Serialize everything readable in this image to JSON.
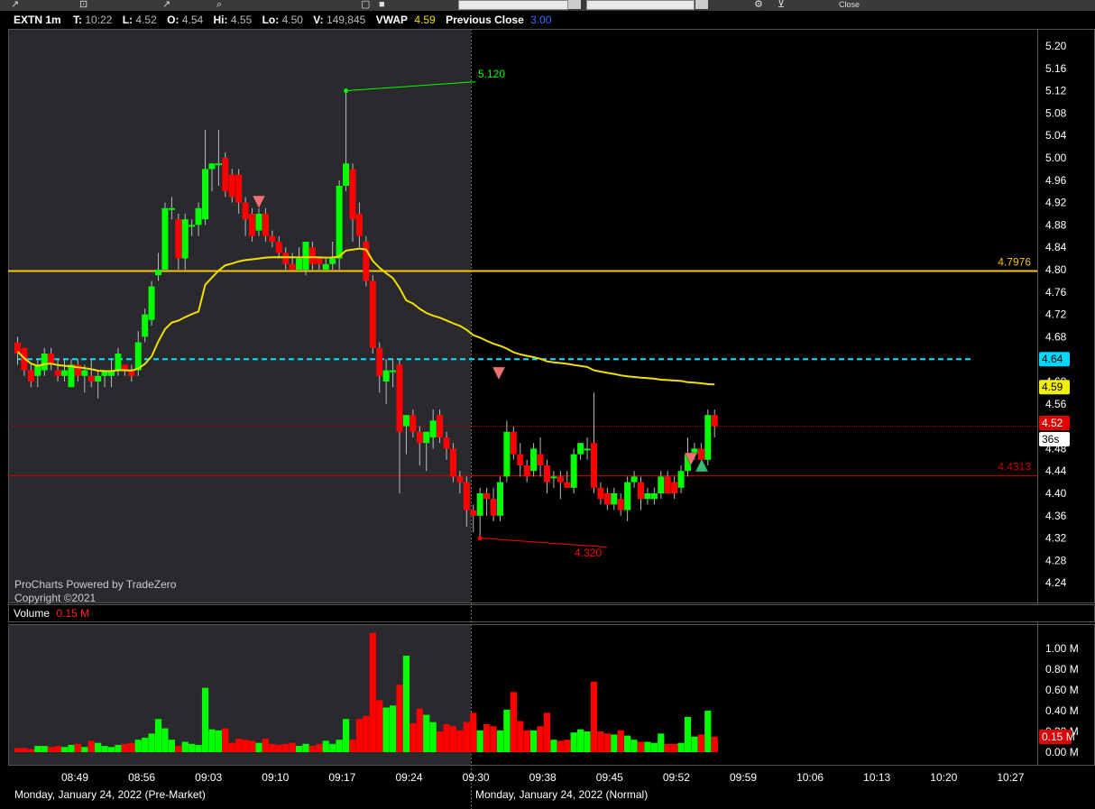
{
  "toolbar": {
    "icons": [
      "cursor-icon",
      "crosshair-icon",
      "draw-line-icon",
      "zoom-icon",
      "undo-icon",
      "save-icon",
      "settings-icon",
      "gear-icon",
      "close-icon"
    ],
    "close_label": "Close"
  },
  "info_bar": {
    "symbol": "EXTN 1m",
    "t_label": "T:",
    "t_value": "10:22",
    "l_label": "L:",
    "l_value": "4.52",
    "o_label": "O:",
    "o_value": "4.54",
    "hi_label": "Hi:",
    "hi_value": "4.55",
    "lo_label": "Lo:",
    "lo_value": "4.50",
    "v_label": "V:",
    "v_value": "149,845",
    "vwap_label": "VWAP",
    "vwap_value": "4.59",
    "prev_label": "Previous Close",
    "prev_value": "3.00"
  },
  "watermark": {
    "line1": "ProCharts Powered by TradeZero",
    "line2": "Copyright ©2021"
  },
  "volume_header": {
    "label": "Volume",
    "value": "0.15 M"
  },
  "sessions": {
    "premarket": "Monday, January 24, 2022 (Pre-Market)",
    "normal": "Monday, January 24, 2022 (Normal)"
  },
  "colors": {
    "up": "#00ff00",
    "down": "#ff0000",
    "vwap": "#f0e000",
    "dashed": "#00e5ff",
    "level": "#f5c518",
    "redline": "#cc0000"
  },
  "chart_data": {
    "type": "candlestick",
    "symbol": "EXTN",
    "interval": "1m",
    "time_axis": [
      "08:49",
      "08:56",
      "09:03",
      "09:10",
      "09:17",
      "09:24",
      "09:30",
      "09:38",
      "09:45",
      "09:52",
      "09:59",
      "10:06",
      "10:13",
      "10:20",
      "10:27"
    ],
    "price_axis": [
      "5.20",
      "5.16",
      "5.12",
      "5.08",
      "5.04",
      "5.00",
      "4.96",
      "4.92",
      "4.88",
      "4.84",
      "4.80",
      "4.76",
      "4.72",
      "4.68",
      "4.64",
      "4.60",
      "4.56",
      "4.52",
      "4.48",
      "4.44",
      "4.40",
      "4.36",
      "4.32",
      "4.28",
      "4.24"
    ],
    "ylim": [
      4.2,
      5.22
    ],
    "volume_axis": [
      "1.00 M",
      "0.80 M",
      "0.60 M",
      "0.40 M",
      "0.20 M",
      "0.00 M"
    ],
    "volume_ylim": [
      0,
      1.1
    ],
    "candles": [
      {
        "o": 4.67,
        "h": 4.68,
        "l": 4.63,
        "c": 4.65
      },
      {
        "o": 4.66,
        "h": 4.66,
        "l": 4.61,
        "c": 4.62
      },
      {
        "o": 4.62,
        "h": 4.63,
        "l": 4.59,
        "c": 4.6
      },
      {
        "o": 4.61,
        "h": 4.64,
        "l": 4.59,
        "c": 4.63
      },
      {
        "o": 4.62,
        "h": 4.66,
        "l": 4.61,
        "c": 4.65
      },
      {
        "o": 4.65,
        "h": 4.66,
        "l": 4.62,
        "c": 4.63
      },
      {
        "o": 4.62,
        "h": 4.64,
        "l": 4.6,
        "c": 4.61
      },
      {
        "o": 4.61,
        "h": 4.64,
        "l": 4.6,
        "c": 4.62
      },
      {
        "o": 4.59,
        "h": 4.64,
        "l": 4.59,
        "c": 4.63
      },
      {
        "o": 4.63,
        "h": 4.64,
        "l": 4.6,
        "c": 4.61
      },
      {
        "o": 4.61,
        "h": 4.63,
        "l": 4.58,
        "c": 4.62
      },
      {
        "o": 4.61,
        "h": 4.64,
        "l": 4.59,
        "c": 4.6
      },
      {
        "o": 4.6,
        "h": 4.62,
        "l": 4.57,
        "c": 4.61
      },
      {
        "o": 4.61,
        "h": 4.62,
        "l": 4.59,
        "c": 4.62
      },
      {
        "o": 4.61,
        "h": 4.64,
        "l": 4.59,
        "c": 4.62
      },
      {
        "o": 4.62,
        "h": 4.66,
        "l": 4.61,
        "c": 4.65
      },
      {
        "o": 4.63,
        "h": 4.63,
        "l": 4.61,
        "c": 4.62
      },
      {
        "o": 4.62,
        "h": 4.63,
        "l": 4.6,
        "c": 4.61
      },
      {
        "o": 4.62,
        "h": 4.69,
        "l": 4.61,
        "c": 4.67
      },
      {
        "o": 4.68,
        "h": 4.73,
        "l": 4.67,
        "c": 4.72
      },
      {
        "o": 4.71,
        "h": 4.78,
        "l": 4.7,
        "c": 4.77
      },
      {
        "o": 4.79,
        "h": 4.83,
        "l": 4.78,
        "c": 4.8
      },
      {
        "o": 4.8,
        "h": 4.92,
        "l": 4.8,
        "c": 4.91
      },
      {
        "o": 4.91,
        "h": 4.93,
        "l": 4.89,
        "c": 4.91
      },
      {
        "o": 4.89,
        "h": 4.9,
        "l": 4.8,
        "c": 4.82
      },
      {
        "o": 4.82,
        "h": 4.9,
        "l": 4.8,
        "c": 4.89
      },
      {
        "o": 4.88,
        "h": 4.89,
        "l": 4.86,
        "c": 4.88
      },
      {
        "o": 4.88,
        "h": 4.92,
        "l": 4.86,
        "c": 4.91
      },
      {
        "o": 4.89,
        "h": 5.05,
        "l": 4.88,
        "c": 4.98
      },
      {
        "o": 4.98,
        "h": 4.99,
        "l": 4.94,
        "c": 4.99
      },
      {
        "o": 4.99,
        "h": 5.05,
        "l": 4.95,
        "c": 4.99
      },
      {
        "o": 5.0,
        "h": 5.01,
        "l": 4.93,
        "c": 4.94
      },
      {
        "o": 4.97,
        "h": 4.98,
        "l": 4.92,
        "c": 4.93
      },
      {
        "o": 4.97,
        "h": 4.98,
        "l": 4.9,
        "c": 4.92
      },
      {
        "o": 4.92,
        "h": 4.93,
        "l": 4.86,
        "c": 4.89
      },
      {
        "o": 4.9,
        "h": 4.91,
        "l": 4.85,
        "c": 4.86
      },
      {
        "o": 4.87,
        "h": 4.91,
        "l": 4.86,
        "c": 4.9
      },
      {
        "o": 4.9,
        "h": 4.91,
        "l": 4.85,
        "c": 4.86
      },
      {
        "o": 4.86,
        "h": 4.87,
        "l": 4.84,
        "c": 4.85
      },
      {
        "o": 4.85,
        "h": 4.86,
        "l": 4.82,
        "c": 4.83
      },
      {
        "o": 4.83,
        "h": 4.84,
        "l": 4.8,
        "c": 4.81
      },
      {
        "o": 4.81,
        "h": 4.83,
        "l": 4.8,
        "c": 4.8
      },
      {
        "o": 4.8,
        "h": 4.84,
        "l": 4.8,
        "c": 4.82
      },
      {
        "o": 4.8,
        "h": 4.85,
        "l": 4.79,
        "c": 4.85
      },
      {
        "o": 4.84,
        "h": 4.85,
        "l": 4.8,
        "c": 4.81
      },
      {
        "o": 4.82,
        "h": 4.82,
        "l": 4.8,
        "c": 4.81
      },
      {
        "o": 4.8,
        "h": 4.82,
        "l": 4.8,
        "c": 4.81
      },
      {
        "o": 4.81,
        "h": 4.85,
        "l": 4.8,
        "c": 4.82
      },
      {
        "o": 4.82,
        "h": 4.96,
        "l": 4.8,
        "c": 4.95
      },
      {
        "o": 4.95,
        "h": 5.12,
        "l": 4.94,
        "c": 4.99
      },
      {
        "o": 4.98,
        "h": 4.99,
        "l": 4.85,
        "c": 4.89
      },
      {
        "o": 4.9,
        "h": 4.92,
        "l": 4.84,
        "c": 4.86
      },
      {
        "o": 4.85,
        "h": 4.86,
        "l": 4.77,
        "c": 4.78
      },
      {
        "o": 4.78,
        "h": 4.79,
        "l": 4.65,
        "c": 4.66
      },
      {
        "o": 4.66,
        "h": 4.67,
        "l": 4.58,
        "c": 4.61
      },
      {
        "o": 4.6,
        "h": 4.64,
        "l": 4.56,
        "c": 4.62
      },
      {
        "o": 4.62,
        "h": 4.64,
        "l": 4.59,
        "c": 4.62
      },
      {
        "o": 4.63,
        "h": 4.64,
        "l": 4.4,
        "c": 4.51
      },
      {
        "o": 4.52,
        "h": 4.54,
        "l": 4.47,
        "c": 4.54
      },
      {
        "o": 4.54,
        "h": 4.55,
        "l": 4.5,
        "c": 4.51
      },
      {
        "o": 4.51,
        "h": 4.52,
        "l": 4.45,
        "c": 4.49
      },
      {
        "o": 4.49,
        "h": 4.51,
        "l": 4.44,
        "c": 4.51
      },
      {
        "o": 4.5,
        "h": 4.55,
        "l": 4.48,
        "c": 4.53
      },
      {
        "o": 4.54,
        "h": 4.55,
        "l": 4.49,
        "c": 4.5
      },
      {
        "o": 4.5,
        "h": 4.51,
        "l": 4.46,
        "c": 4.48
      },
      {
        "o": 4.48,
        "h": 4.49,
        "l": 4.42,
        "c": 4.43
      },
      {
        "o": 4.43,
        "h": 4.44,
        "l": 4.4,
        "c": 4.42
      },
      {
        "o": 4.42,
        "h": 4.43,
        "l": 4.34,
        "c": 4.37
      },
      {
        "o": 4.37,
        "h": 4.38,
        "l": 4.33,
        "c": 4.36
      },
      {
        "o": 4.36,
        "h": 4.41,
        "l": 4.32,
        "c": 4.4
      },
      {
        "o": 4.4,
        "h": 4.41,
        "l": 4.36,
        "c": 4.39
      },
      {
        "o": 4.39,
        "h": 4.41,
        "l": 4.35,
        "c": 4.36
      },
      {
        "o": 4.36,
        "h": 4.43,
        "l": 4.35,
        "c": 4.42
      },
      {
        "o": 4.43,
        "h": 4.53,
        "l": 4.42,
        "c": 4.51
      },
      {
        "o": 4.51,
        "h": 4.52,
        "l": 4.46,
        "c": 4.47
      },
      {
        "o": 4.47,
        "h": 4.49,
        "l": 4.43,
        "c": 4.45
      },
      {
        "o": 4.45,
        "h": 4.46,
        "l": 4.42,
        "c": 4.43
      },
      {
        "o": 4.44,
        "h": 4.49,
        "l": 4.43,
        "c": 4.48
      },
      {
        "o": 4.47,
        "h": 4.5,
        "l": 4.43,
        "c": 4.45
      },
      {
        "o": 4.45,
        "h": 4.46,
        "l": 4.4,
        "c": 4.42
      },
      {
        "o": 4.43,
        "h": 4.44,
        "l": 4.41,
        "c": 4.43
      },
      {
        "o": 4.43,
        "h": 4.44,
        "l": 4.39,
        "c": 4.42
      },
      {
        "o": 4.42,
        "h": 4.44,
        "l": 4.41,
        "c": 4.41
      },
      {
        "o": 4.41,
        "h": 4.48,
        "l": 4.4,
        "c": 4.47
      },
      {
        "o": 4.47,
        "h": 4.49,
        "l": 4.46,
        "c": 4.49
      },
      {
        "o": 4.48,
        "h": 4.5,
        "l": 4.46,
        "c": 4.48
      },
      {
        "o": 4.49,
        "h": 4.58,
        "l": 4.4,
        "c": 4.41
      },
      {
        "o": 4.41,
        "h": 4.42,
        "l": 4.38,
        "c": 4.39
      },
      {
        "o": 4.4,
        "h": 4.41,
        "l": 4.37,
        "c": 4.38
      },
      {
        "o": 4.38,
        "h": 4.41,
        "l": 4.37,
        "c": 4.4
      },
      {
        "o": 4.39,
        "h": 4.4,
        "l": 4.36,
        "c": 4.37
      },
      {
        "o": 4.37,
        "h": 4.43,
        "l": 4.35,
        "c": 4.42
      },
      {
        "o": 4.42,
        "h": 4.44,
        "l": 4.41,
        "c": 4.43
      },
      {
        "o": 4.42,
        "h": 4.43,
        "l": 4.37,
        "c": 4.39
      },
      {
        "o": 4.39,
        "h": 4.41,
        "l": 4.38,
        "c": 4.4
      },
      {
        "o": 4.39,
        "h": 4.41,
        "l": 4.38,
        "c": 4.4
      },
      {
        "o": 4.4,
        "h": 4.44,
        "l": 4.39,
        "c": 4.43
      },
      {
        "o": 4.43,
        "h": 4.44,
        "l": 4.4,
        "c": 4.4
      },
      {
        "o": 4.42,
        "h": 4.43,
        "l": 4.39,
        "c": 4.4
      },
      {
        "o": 4.41,
        "h": 4.45,
        "l": 4.4,
        "c": 4.44
      },
      {
        "o": 4.44,
        "h": 4.5,
        "l": 4.43,
        "c": 4.47
      },
      {
        "o": 4.47,
        "h": 4.49,
        "l": 4.46,
        "c": 4.48
      },
      {
        "o": 4.48,
        "h": 4.49,
        "l": 4.45,
        "c": 4.46
      },
      {
        "o": 4.46,
        "h": 4.55,
        "l": 4.45,
        "c": 4.54
      },
      {
        "o": 4.54,
        "h": 4.55,
        "l": 4.5,
        "c": 4.52
      }
    ],
    "volumes": [
      0.04,
      0.04,
      0.03,
      0.06,
      0.06,
      0.05,
      0.06,
      0.05,
      0.07,
      0.08,
      0.05,
      0.11,
      0.09,
      0.06,
      0.05,
      0.07,
      0.08,
      0.09,
      0.12,
      0.14,
      0.18,
      0.32,
      0.23,
      0.12,
      0.06,
      0.1,
      0.08,
      0.07,
      0.62,
      0.22,
      0.21,
      0.23,
      0.09,
      0.13,
      0.12,
      0.11,
      0.09,
      0.13,
      0.08,
      0.07,
      0.08,
      0.09,
      0.06,
      0.08,
      0.06,
      0.08,
      0.11,
      0.08,
      0.12,
      0.32,
      0.12,
      0.32,
      0.35,
      1.15,
      0.5,
      0.43,
      0.45,
      0.65,
      0.93,
      0.28,
      0.42,
      0.36,
      0.29,
      0.2,
      0.27,
      0.25,
      0.21,
      0.29,
      0.38,
      0.21,
      0.27,
      0.25,
      0.21,
      0.41,
      0.58,
      0.3,
      0.21,
      0.21,
      0.25,
      0.38,
      0.12,
      0.11,
      0.12,
      0.19,
      0.22,
      0.2,
      0.68,
      0.2,
      0.18,
      0.17,
      0.21,
      0.16,
      0.12,
      0.1,
      0.1,
      0.09,
      0.18,
      0.08,
      0.08,
      0.09,
      0.34,
      0.15,
      0.17,
      0.4,
      0.15
    ],
    "vwap_label": "4.59",
    "current_price_label": "4.52",
    "countdown_label": "36s",
    "dashed_level_label": "4.64",
    "horizontal_levels": [
      {
        "value": 4.7976,
        "label": "4.7976",
        "color": "#f5c518"
      },
      {
        "value": 4.4313,
        "label": "4.4313",
        "color": "#cc0000"
      }
    ],
    "annotations": [
      {
        "label": "5.120",
        "value": 5.12,
        "color": "#00ff00"
      },
      {
        "label": "4.320",
        "value": 4.32,
        "color": "#ff0000"
      }
    ]
  }
}
